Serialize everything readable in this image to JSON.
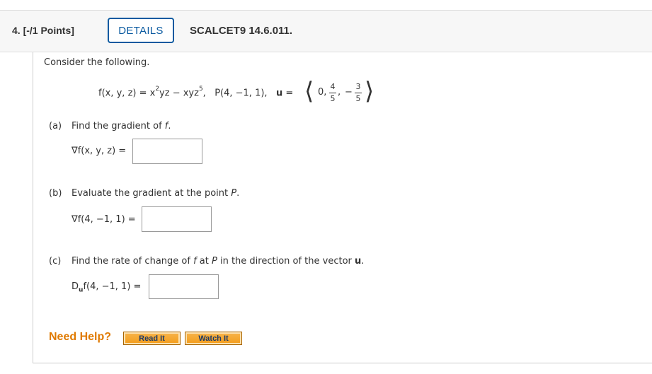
{
  "header": {
    "question_number": "4. [-/1 Points]",
    "details_label": "DETAILS",
    "problem_code": "SCALCET9 14.6.011."
  },
  "problem": {
    "intro": "Consider the following.",
    "function_lhs": "f(x, y, z) = x",
    "exp_2": "2",
    "function_mid": "yz − xyz",
    "exp_5": "5",
    "point": ",   P(4, −1, 1),   ",
    "vector_name": "u",
    "vector_eq": " = ",
    "vector_first": "0,",
    "num_4": "4",
    "den_5a": "5",
    "comma": ",",
    "minus": "−",
    "num_3": "3",
    "den_5b": "5"
  },
  "part_a": {
    "label": "(a)",
    "prompt_pre": "Find the gradient of ",
    "prompt_var": "f",
    "prompt_post": ".",
    "answer_label": "∇f(x, y, z) ="
  },
  "part_b": {
    "label": "(b)",
    "prompt_pre": "Evaluate the gradient at the point ",
    "prompt_var": "P",
    "prompt_post": ".",
    "answer_label": "∇f(4, −1, 1) ="
  },
  "part_c": {
    "label": "(c)",
    "prompt_1": "Find the rate of change of ",
    "var_f": "f",
    "prompt_2": " at ",
    "var_p": "P",
    "prompt_3": " in the direction of the vector ",
    "var_u": "u",
    "prompt_4": ".",
    "answer_D": "D",
    "answer_sub": "u",
    "answer_rest": "f(4, −1, 1) ="
  },
  "help": {
    "label": "Need Help?",
    "read_it": "Read It",
    "watch_it": "Watch It"
  }
}
